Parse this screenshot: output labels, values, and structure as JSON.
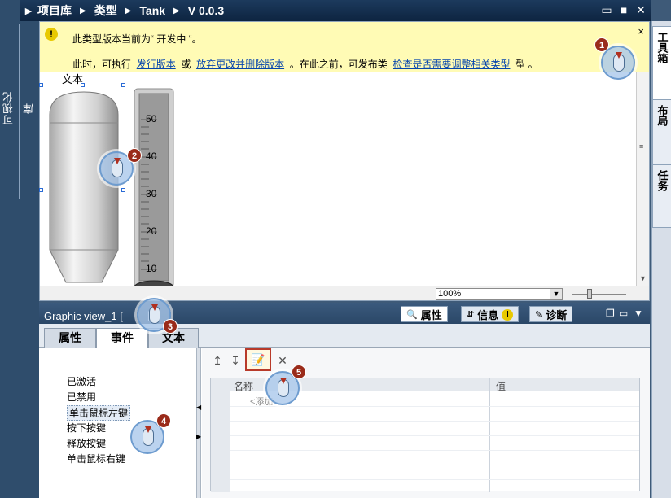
{
  "left_tabs": [
    "可视化",
    "库"
  ],
  "breadcrumb": [
    "项目库",
    "类型",
    "Tank",
    "V 0.0.3"
  ],
  "window_controls": [
    "_",
    "▭",
    "■",
    "✕"
  ],
  "right_tabs": [
    "工具箱",
    "布局",
    "任务"
  ],
  "notice": {
    "icon": "!",
    "line1": "此类型版本当前为“ 开发中 “。",
    "line2_prefix": "此时，可执行",
    "link1": "发行版本",
    "or": "或",
    "link2": "放弃更改并删除版本",
    "mid": "。在此之前，可发布类",
    "link3": "检查是否需要调整相关类型",
    "suffix": "型 。",
    "close": "×"
  },
  "canvas": {
    "text_label": "文本",
    "gauge_ticks": [
      "50",
      "40",
      "30",
      "20",
      "10"
    ],
    "zoom": "100%"
  },
  "properties": {
    "title": "Graphic view_1 [ ... 图]",
    "title_prefix": "Graphic view_1 [",
    "title_suffix": "图]",
    "header_tabs": [
      "属性",
      "信息",
      "诊断"
    ],
    "sub_tabs": [
      "属性",
      "事件",
      "文本"
    ],
    "events": [
      "已激活",
      "已禁用",
      "单击鼠标左键",
      "按下按键",
      "释放按键",
      "单击鼠标右键"
    ],
    "selected_event": "单击鼠标左键",
    "grid": {
      "col_name": "名称",
      "col_value": "值",
      "add_placeholder": "<添加..."
    }
  },
  "callouts": [
    "1",
    "2",
    "3",
    "4",
    "5"
  ]
}
